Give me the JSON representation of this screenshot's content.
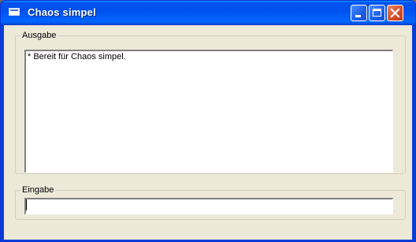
{
  "window": {
    "title": "Chaos simpel"
  },
  "output": {
    "label": "Ausgabe",
    "lines": [
      "* Bereit für Chaos simpel."
    ]
  },
  "input": {
    "label": "Eingabe",
    "value": ""
  },
  "icons": {
    "app": "window-icon",
    "minimize": "minimize-icon",
    "maximize": "maximize-icon",
    "close": "close-icon"
  }
}
